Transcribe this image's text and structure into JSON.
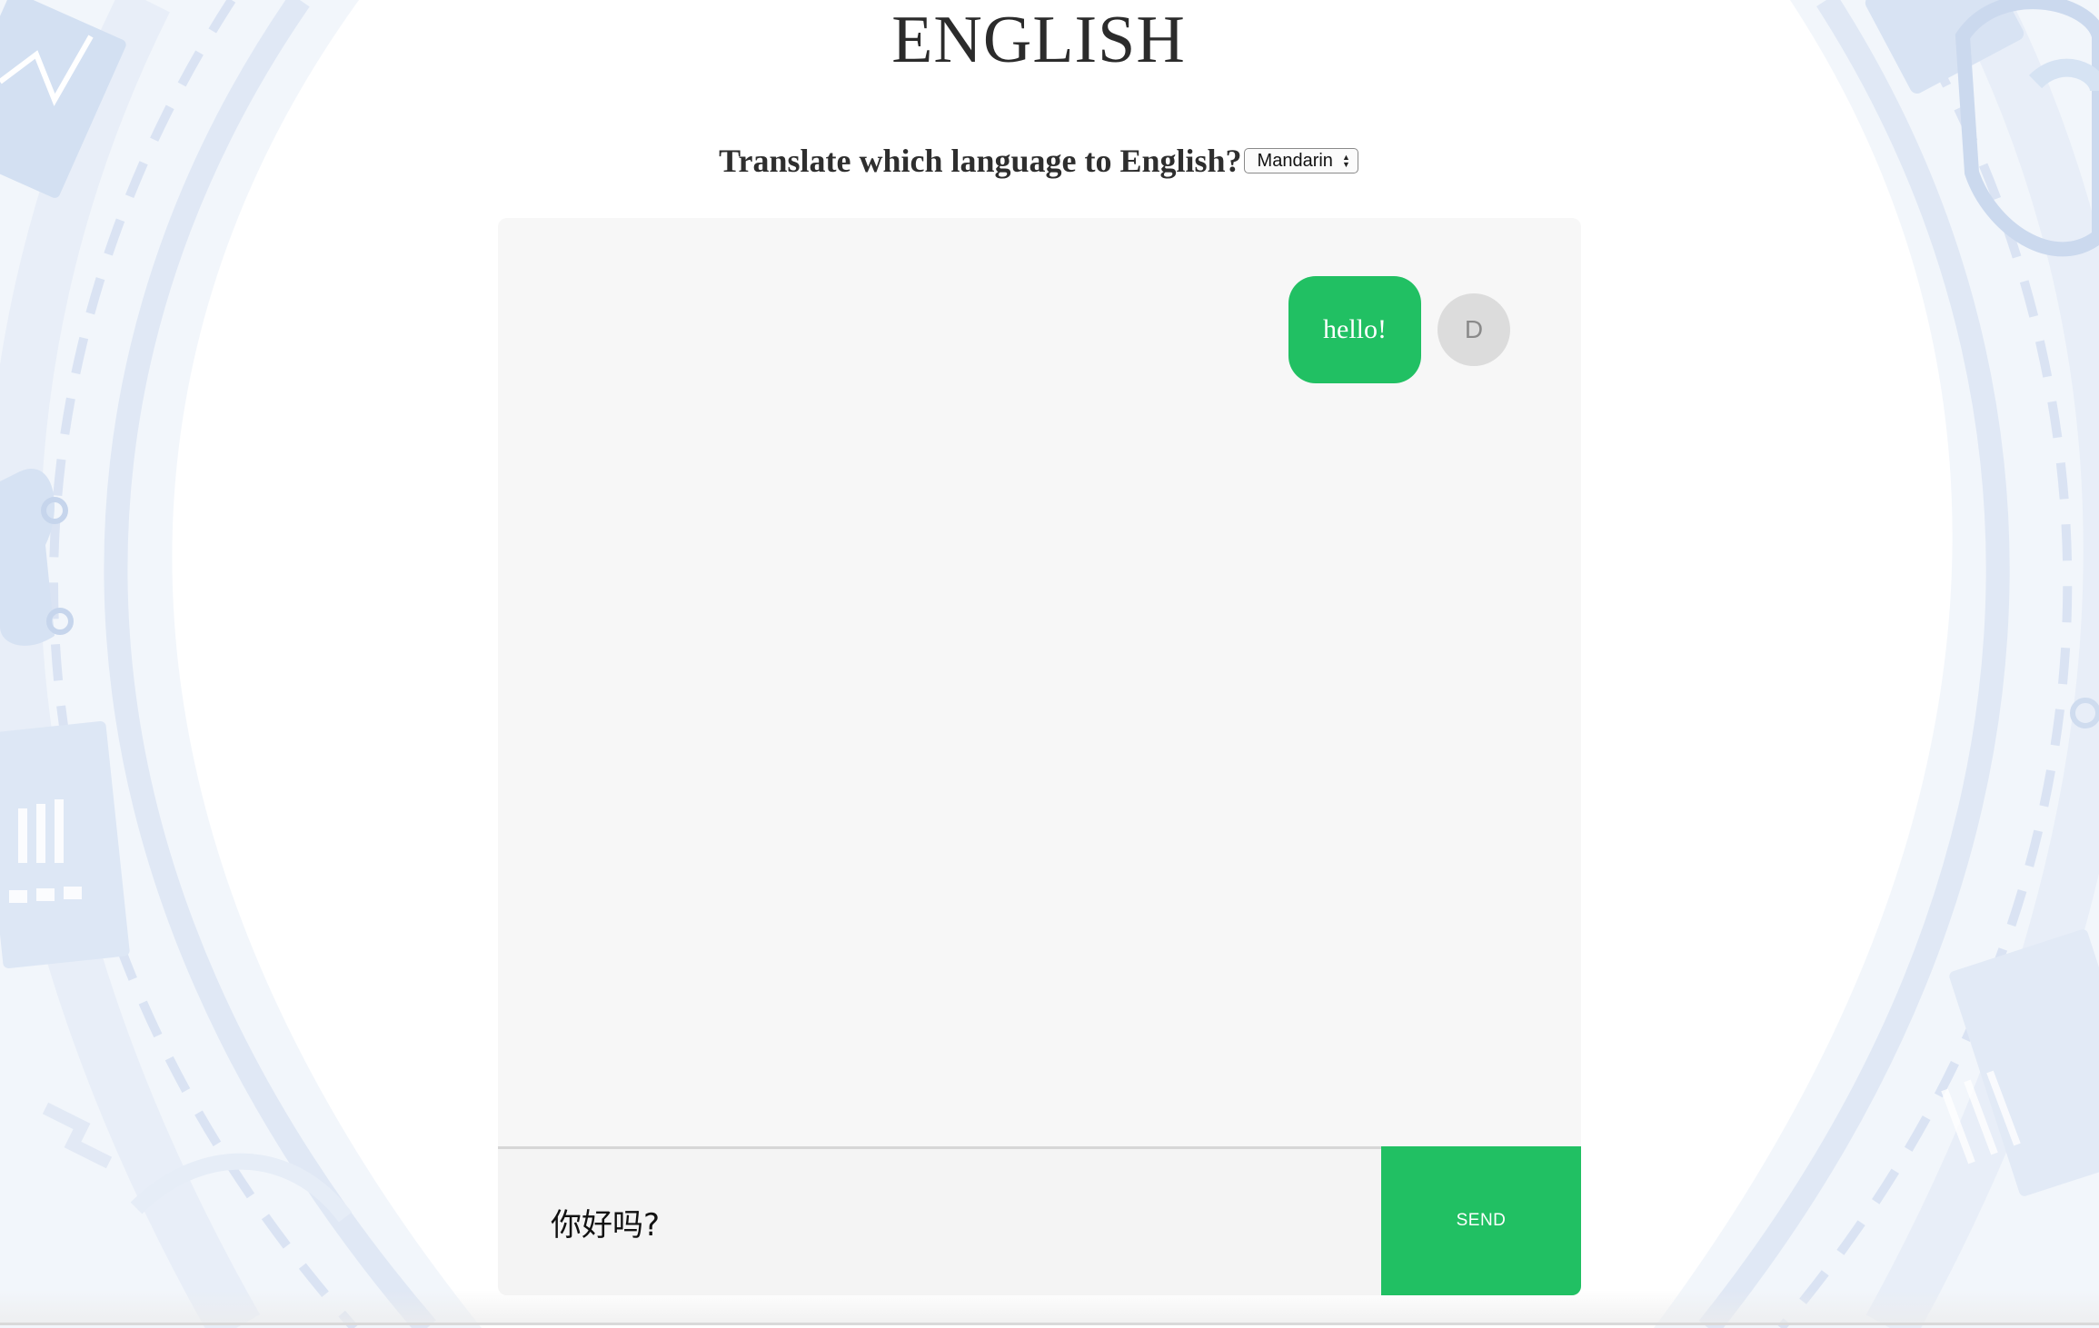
{
  "header": {
    "title": "ENGLISH",
    "question": "Translate which language to English?",
    "language_select": {
      "selected": "Mandarin",
      "icon": "up-down-arrows-icon"
    }
  },
  "chat": {
    "messages": [
      {
        "text": "hello!",
        "sender_initial": "D",
        "side": "right"
      }
    ],
    "composer": {
      "value": "你好吗?",
      "send_label": "SEND"
    }
  },
  "colors": {
    "accent": "#21c063",
    "chat_background": "#f7f7f7",
    "avatar_background": "#dcdcdc",
    "title_text": "#2b2b2b"
  }
}
